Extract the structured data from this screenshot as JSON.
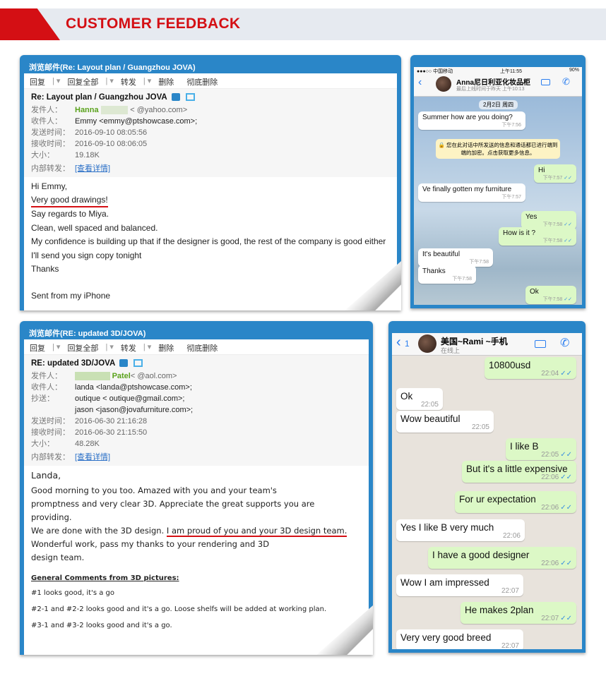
{
  "banner": {
    "title": "CUSTOMER FEEDBACK",
    "accent": "#d40f14"
  },
  "email1": {
    "window_title": "浏览邮件(Re: Layout plan  / Guangzhou JOVA)",
    "toolbar": [
      "回复",
      "回复全部",
      "转发",
      "删除",
      "彻底删除"
    ],
    "subject": "Re: Layout plan / Guangzhou JOVA",
    "labels": {
      "from": "发件人：",
      "to": "收件人：",
      "sent": "发送时间：",
      "received": "接收时间：",
      "size": "大小：",
      "forward": "内部转发："
    },
    "from_name": "Hanna",
    "from_email": "<          @yahoo.com>",
    "to": "Emmy <emmy@ptshowcase.com>;",
    "sent": "2016-09-10 08:05:56",
    "received": "2016-09-10 08:06:05",
    "size": "19.18K",
    "details_link": "[查看详情]",
    "body": [
      "Hi Emmy,",
      "Very good drawings!",
      "Say regards to Miya.",
      "Clean, well spaced and balanced.",
      "My confidence is building up that if the designer is good, the rest of the company is good either",
      "I'll send you sign copy tonight",
      "Thanks",
      "",
      "Sent from my iPhone"
    ]
  },
  "chat1": {
    "status": {
      "carrier": "●●●○○ 中国移动",
      "time": "上午11:55",
      "battery": "90%"
    },
    "contact": "Anna尼日利亚化妆品柜",
    "last_seen": "最后上线时间于昨天 上午10:13",
    "date_chip": "2月2日 周四",
    "notice": "🔒 您在此对话中所发送的信息和通话都已进行端到端的加密。点击获取更多信息。",
    "messages": [
      {
        "dir": "in",
        "text": "Summer how are you doing?",
        "time": "下午7:56"
      },
      {
        "dir": "out",
        "text": "Hi",
        "time": "下午7:57"
      },
      {
        "dir": "in",
        "text": "Ve finally gotten my furniture",
        "time": "下午7:57"
      },
      {
        "dir": "out",
        "text": "Yes",
        "time": "下午7:58"
      },
      {
        "dir": "out",
        "text": "How is it ?",
        "time": "下午7:58"
      },
      {
        "dir": "in",
        "text": "It's beautiful",
        "time": "下午7:58"
      },
      {
        "dir": "in",
        "text": "Thanks",
        "time": "下午7:58"
      },
      {
        "dir": "out",
        "text": "Ok",
        "time": "下午7:58"
      }
    ]
  },
  "email2": {
    "window_title": "浏览邮件(RE: updated 3D/JOVA)",
    "toolbar": [
      "回复",
      "回复全部",
      "转发",
      "删除",
      "彻底删除"
    ],
    "subject": "RE: updated 3D/JOVA",
    "labels": {
      "from": "发件人：",
      "to": "收件人：",
      "cc": "抄送：",
      "sent": "发送时间：",
      "received": "接收时间：",
      "size": "大小：",
      "forward": "内部转发："
    },
    "from_name": "Patel",
    "from_email": "<          @aol.com>",
    "to": "landa <landa@ptshowcase.com>;",
    "cc1": "          outique <          outique@gmail.com>;",
    "cc2": "jason <jason@jovafurniture.com>;",
    "sent": "2016-06-30 21:16:28",
    "received": "2016-06-30 21:15:50",
    "size": "48.28K",
    "details_link": "[查看详情]",
    "greeting": "Landa,",
    "body": [
      "Good morning to you too.  Amazed with you and your team's",
      "promptness and very clear 3D.  Appreciate the great supports you are",
      "providing."
    ],
    "line_before": "We are done with the 3D design.  ",
    "highlight": "I am proud of you and your 3D design team.",
    "body2": [
      "Wonderful work, pass my thanks to your rendering and 3D",
      "design team."
    ],
    "comments_title": "General Comments from 3D pictures:",
    "comments": [
      "#1 looks good, it's a go",
      "#2-1 and #2-2 looks good and it's a go.  Loose shelfs will be added at working plan.",
      "#3-1 and #3-2 looks good and it's a go."
    ]
  },
  "chat2": {
    "back": "1",
    "contact": "美国~Rami ~手机",
    "status": "在线上",
    "messages": [
      {
        "dir": "out",
        "text": "10800usd",
        "time": "22:04"
      },
      {
        "dir": "in",
        "text": "Ok",
        "time": "22:05"
      },
      {
        "dir": "in",
        "text": "Wow beautiful",
        "time": "22:05"
      },
      {
        "dir": "out",
        "text": "I like B",
        "time": "22:05"
      },
      {
        "dir": "out",
        "text": "But it's a little expensive",
        "time": "22:06"
      },
      {
        "dir": "out",
        "text": "For ur expectation",
        "time": "22:06"
      },
      {
        "dir": "in",
        "text": "Yes I like B very much",
        "time": "22:06"
      },
      {
        "dir": "out",
        "text": "I have a good designer",
        "time": "22:06"
      },
      {
        "dir": "in",
        "text": "Wow I am impressed",
        "time": "22:07"
      },
      {
        "dir": "out",
        "text": "He makes 2plan",
        "time": "22:07"
      },
      {
        "dir": "in",
        "text": "Very very good breed",
        "time": "22:07"
      }
    ]
  }
}
